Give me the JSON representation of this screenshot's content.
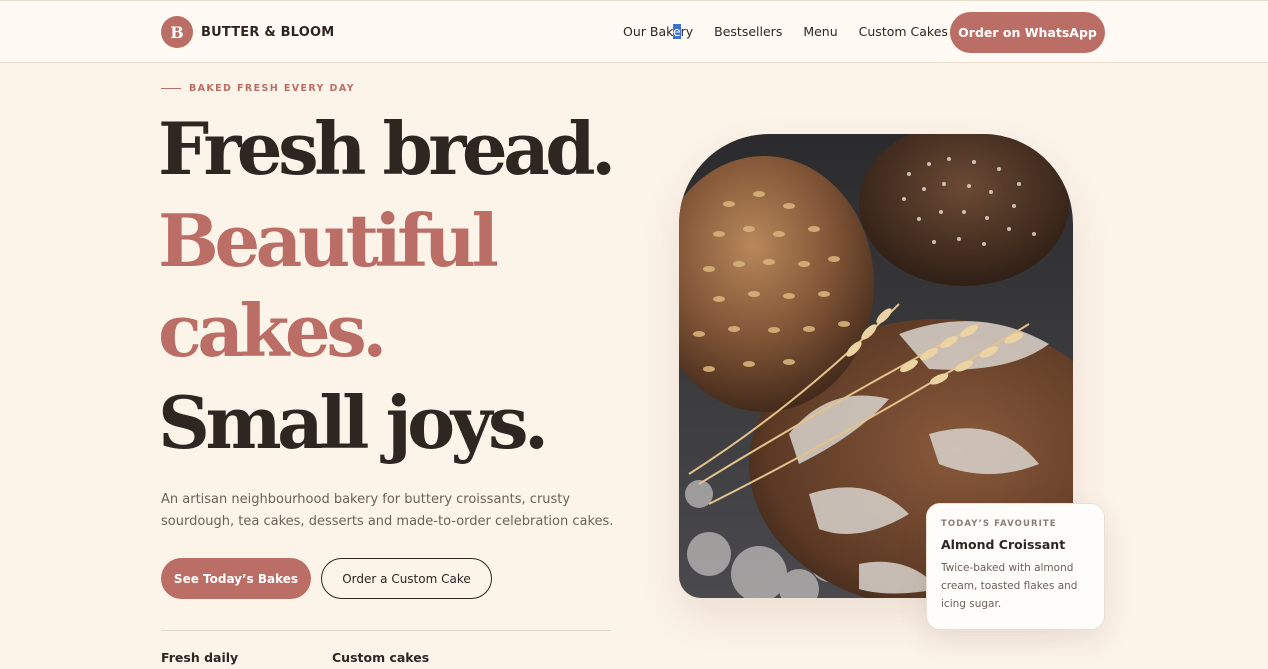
{
  "nav": {
    "brand_mark": "B",
    "brand_name": "BUTTER & BLOOM",
    "links": [
      {
        "label_pre": "Our Bak",
        "label_sel": "e",
        "label_post": "ry"
      },
      {
        "label": "Bestsellers"
      },
      {
        "label": "Menu"
      },
      {
        "label": "Custom Cakes"
      }
    ],
    "order_button": "Order on WhatsApp"
  },
  "hero": {
    "eyebrow": "BAKED FRESH EVERY DAY",
    "headline": [
      "Fresh bread.",
      "Beautiful",
      "cakes.",
      "Small joys."
    ],
    "lead": "An artisan neighbourhood bakery for buttery croissants, crusty sourdough, tea cakes, desserts and made-to-order celebration cakes.",
    "primary_button": "See Today’s Bakes",
    "secondary_button": "Order a Custom Cake",
    "stats": [
      "Fresh daily",
      "Custom cakes"
    ]
  },
  "card": {
    "eyebrow": "TODAY’S FAVOURITE",
    "title": "Almond Croissant",
    "text": "Twice-baked with almond cream, toasted flakes and icing sugar."
  },
  "colors": {
    "accent": "#bb6e66",
    "background": "#fcf3e9",
    "text": "#2f2622",
    "selection": "#3f6fd1"
  },
  "icons": {
    "brand": "letter-b-logo-icon",
    "hero_image": "bread-loaves-with-wheat-photo"
  }
}
